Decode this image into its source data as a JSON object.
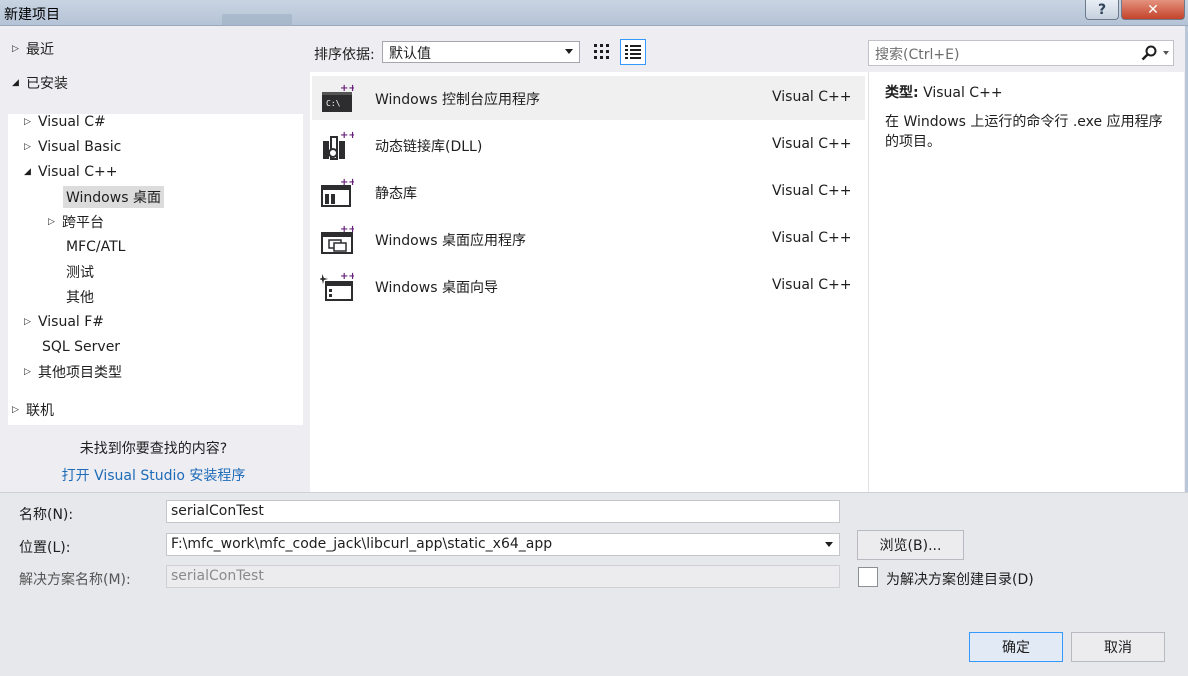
{
  "window": {
    "title": "新建项目",
    "help_label": "?",
    "close_label": "✕"
  },
  "tree": {
    "recent": "最近",
    "installed": "已安装",
    "items": [
      "Visual C#",
      "Visual Basic",
      "Visual C++",
      "Windows 桌面",
      "跨平台",
      "MFC/ATL",
      "测试",
      "其他",
      "Visual F#",
      "SQL Server",
      "其他项目类型"
    ],
    "online": "联机",
    "not_found": "未找到你要查找的内容?",
    "open_installer": "打开 Visual Studio 安装程序"
  },
  "toolbar": {
    "sort_label": "排序依据:",
    "sort_value": "默认值"
  },
  "templates": [
    {
      "name": "Windows 控制台应用程序",
      "lang": "Visual C++",
      "icon": "console-app-icon",
      "selected": true
    },
    {
      "name": "动态链接库(DLL)",
      "lang": "Visual C++",
      "icon": "dll-icon",
      "selected": false
    },
    {
      "name": "静态库",
      "lang": "Visual C++",
      "icon": "static-library-icon",
      "selected": false
    },
    {
      "name": "Windows 桌面应用程序",
      "lang": "Visual C++",
      "icon": "desktop-app-icon",
      "selected": false
    },
    {
      "name": "Windows 桌面向导",
      "lang": "Visual C++",
      "icon": "desktop-wizard-icon",
      "selected": false
    }
  ],
  "search": {
    "placeholder": "搜索(Ctrl+E)"
  },
  "info": {
    "type_label": "类型:",
    "type_value": "Visual C++",
    "description": "在 Windows 上运行的命令行 .exe 应用程序的项目。"
  },
  "form": {
    "name_label": "名称(N):",
    "name_value": "serialConTest",
    "location_label": "位置(L):",
    "location_value": "F:\\mfc_work\\mfc_code_jack\\libcurl_app\\static_x64_app",
    "solution_label": "解决方案名称(M):",
    "solution_value": "serialConTest",
    "browse_label": "浏览(B)...",
    "create_dir_label": "为解决方案创建目录(D)",
    "ok_label": "确定",
    "cancel_label": "取消"
  },
  "colors": {
    "accent": "#3399ff",
    "link": "#1e6bb8",
    "cpp_purple": "#68217a"
  }
}
